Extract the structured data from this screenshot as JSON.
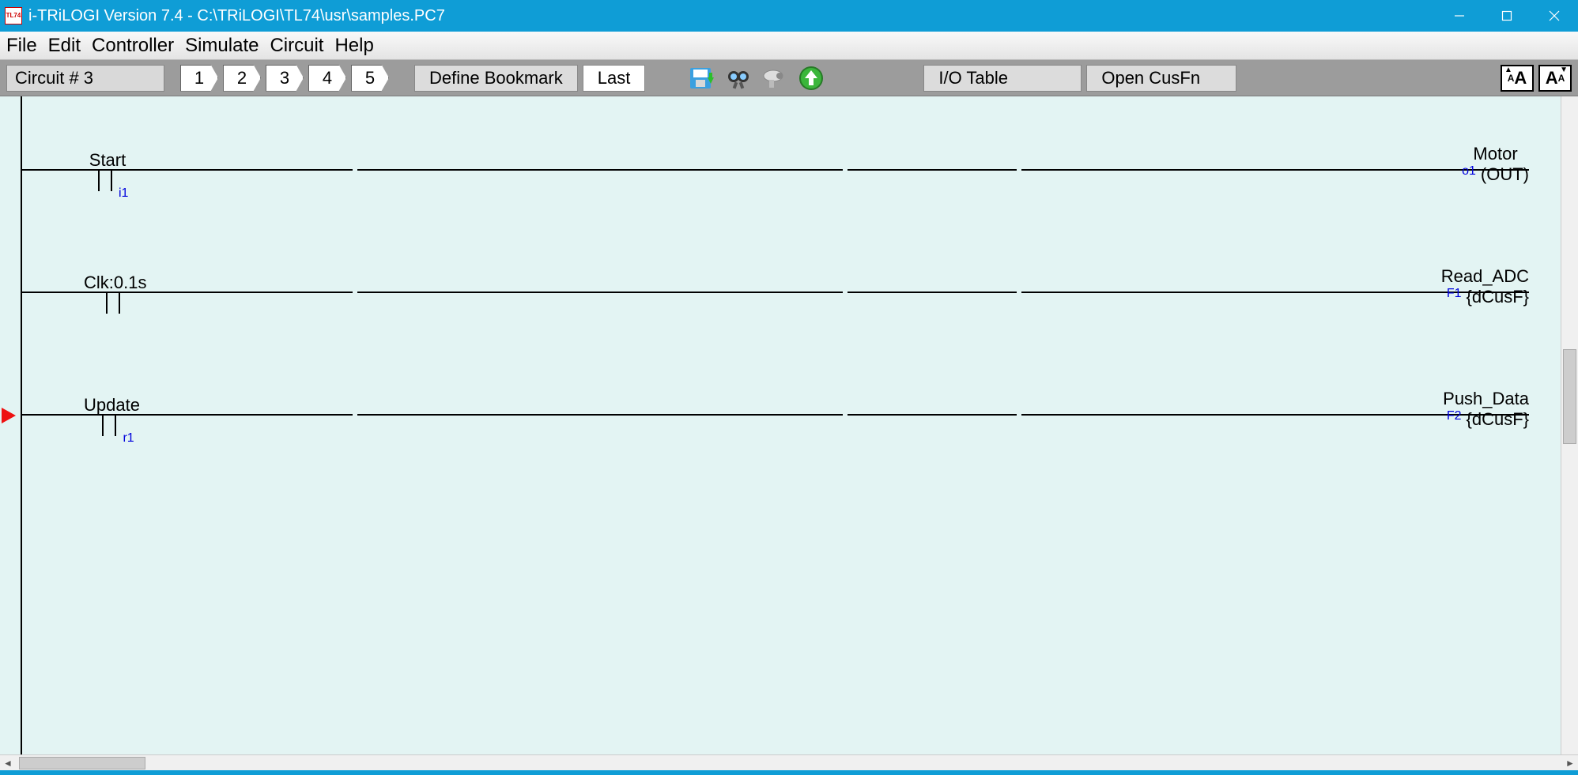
{
  "title": "i-TRiLOGI Version 7.4 - C:\\TRiLOGI\\TL74\\usr\\samples.PC7",
  "appicon_text": "TL74",
  "menu": [
    "File",
    "Edit",
    "Controller",
    "Simulate",
    "Circuit",
    "Help"
  ],
  "toolbar": {
    "circuit_label": "Circuit # 3",
    "bookmarks": [
      "1",
      "2",
      "3",
      "4",
      "5"
    ],
    "define_bookmark": "Define Bookmark",
    "last": "Last",
    "io_table": "I/O Table",
    "open_cusfn": "Open CusFn",
    "font_small": "A",
    "font_big": "A"
  },
  "rungs": [
    {
      "contact": {
        "label": "Start",
        "tag": "i1"
      },
      "coil": {
        "label": "Motor",
        "tag": "o1",
        "shape": "(OUT)"
      },
      "selected": false
    },
    {
      "contact": {
        "label": "Clk:0.1s",
        "tag": ""
      },
      "coil": {
        "label": "Read_ADC",
        "tag": "F1",
        "shape": "{dCusF}"
      },
      "selected": false
    },
    {
      "contact": {
        "label": "Update",
        "tag": "r1"
      },
      "coil": {
        "label": "Push_Data",
        "tag": "F2",
        "shape": "{dCusF}"
      },
      "selected": true
    }
  ]
}
